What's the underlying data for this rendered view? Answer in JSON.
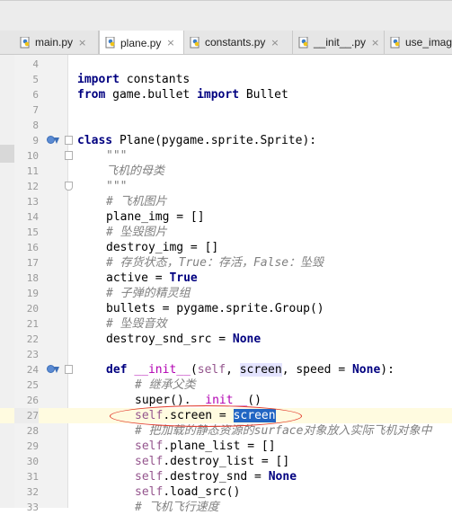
{
  "tabs": [
    {
      "label": "main.py",
      "close": "×",
      "active": false
    },
    {
      "label": "plane.py",
      "close": "×",
      "active": true
    },
    {
      "label": "constants.py",
      "close": "×",
      "active": false
    },
    {
      "label": "__init__.py",
      "close": "×",
      "active": false
    },
    {
      "label": "use_imag",
      "close": "",
      "active": false
    }
  ],
  "icons": {
    "tab_file": "python-file-icon",
    "breakpoint": "implements-arrow-icon",
    "fold": "fold-marker-icon"
  },
  "colors": {
    "keyword": "#000080",
    "comment": "#808080",
    "self": "#94558d",
    "selection": "#2165c3",
    "annotation": "#e23a2a"
  },
  "editor": {
    "current_line": 27,
    "lines": [
      {
        "n": "4"
      },
      {
        "n": "5"
      },
      {
        "n": "6"
      },
      {
        "n": "7"
      },
      {
        "n": "8"
      },
      {
        "n": "9"
      },
      {
        "n": "10"
      },
      {
        "n": "11"
      },
      {
        "n": "12"
      },
      {
        "n": "13"
      },
      {
        "n": "14"
      },
      {
        "n": "15"
      },
      {
        "n": "16"
      },
      {
        "n": "17"
      },
      {
        "n": "18"
      },
      {
        "n": "19"
      },
      {
        "n": "20"
      },
      {
        "n": "21"
      },
      {
        "n": "22"
      },
      {
        "n": "23"
      },
      {
        "n": "24"
      },
      {
        "n": "25"
      },
      {
        "n": "26"
      },
      {
        "n": "27"
      },
      {
        "n": "28"
      },
      {
        "n": "29"
      },
      {
        "n": "30"
      },
      {
        "n": "31"
      },
      {
        "n": "32"
      },
      {
        "n": "33"
      }
    ],
    "code": {
      "l5_kw": "import",
      "l5_rest": " constants",
      "l6_kw1": "from",
      "l6_mid": " game.bullet ",
      "l6_kw2": "import",
      "l6_rest": " Bullet",
      "l9_kw": "class",
      "l9_rest": " Plane(pygame.sprite.Sprite):",
      "l10": "\"\"\"",
      "l11": "飞机的母类",
      "l12": "\"\"\"",
      "l13": "# 飞机图片",
      "l14": "plane_img = []",
      "l15": "# 坠毁图片",
      "l16": "destroy_img = []",
      "l17": "# 存货状态，True：存活，False：坠毁",
      "l18_a": "active = ",
      "l18_kw": "True",
      "l19": "# 子弹的精灵组",
      "l20": "bullets = pygame.sprite.Group()",
      "l21": "# 坠毁音效",
      "l22_a": "destroy_snd_src = ",
      "l22_kw": "None",
      "l24_kw": "def",
      "l24_sp": " ",
      "l24_init": "__init__",
      "l24_p1": "(",
      "l24_self": "self",
      "l24_c1": ", ",
      "l24_screen": "screen",
      "l24_c2": ", speed = ",
      "l24_none": "None",
      "l24_end": "):",
      "l25": "# 继承父类",
      "l26_a": "super().",
      "l26_init": "__init__",
      "l26_b": "()",
      "l27_self": "self",
      "l27_mid": ".screen = ",
      "l27_sel": "screen",
      "l28": "# 把加载的静态资源的surface对象放入实际飞机对象中",
      "l29_self": "self",
      "l29_rest": ".plane_list = []",
      "l30_self": "self",
      "l30_rest": ".destroy_list = []",
      "l31_self": "self",
      "l31_mid": ".destroy_snd = ",
      "l31_kw": "None",
      "l32_self": "self",
      "l32_rest": ".load_src()",
      "l33": "# 飞机飞行速度"
    }
  }
}
